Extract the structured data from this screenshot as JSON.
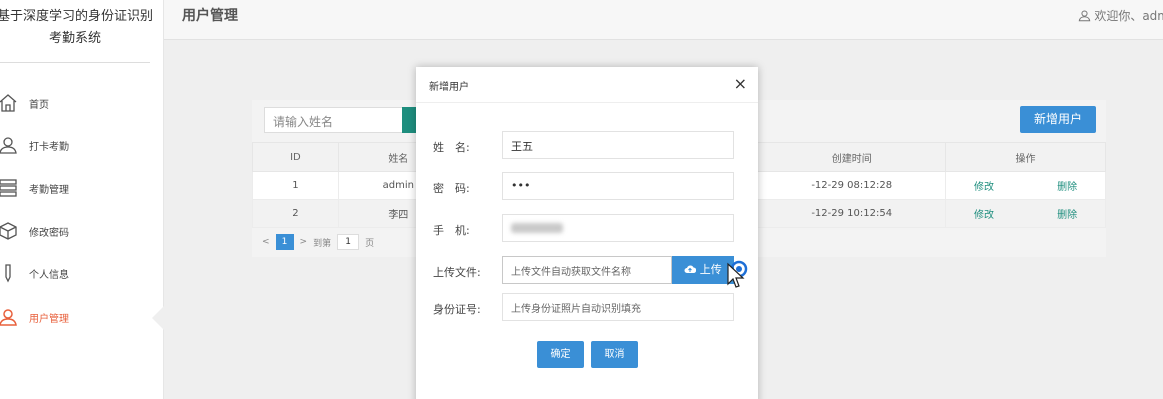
{
  "sidebar": {
    "brand_line1": "基于深度学习的身份证识别",
    "brand_line2": "考勤系统",
    "items": [
      {
        "label": "首页",
        "icon": "home-icon"
      },
      {
        "label": "打卡考勤",
        "icon": "user-icon"
      },
      {
        "label": "考勤管理",
        "icon": "list-icon"
      },
      {
        "label": "修改密码",
        "icon": "box-icon"
      },
      {
        "label": "个人信息",
        "icon": "pen-icon"
      },
      {
        "label": "用户管理",
        "icon": "user-manage-icon",
        "active": true
      }
    ]
  },
  "header": {
    "title": "用户管理",
    "welcome": "欢迎你、adm"
  },
  "toolbar": {
    "search_placeholder": "请输入姓名",
    "add_label": "新增用户"
  },
  "table": {
    "columns": [
      "ID",
      "姓名",
      "创建时间",
      "操作"
    ],
    "rows": [
      {
        "id": "1",
        "name": "admin",
        "time": "-12-29 08:12:28",
        "edit": "修改",
        "delete": "删除"
      },
      {
        "id": "2",
        "name": "李四",
        "time": "-12-29 10:12:54",
        "edit": "修改",
        "delete": "删除"
      }
    ]
  },
  "pager": {
    "current": "1",
    "goto_label": "到第",
    "goto_value": "1",
    "page_suffix": "页"
  },
  "modal": {
    "title": "新增用户",
    "close": "×",
    "name_label": "姓　名:",
    "name_value": "王五",
    "password_label": "密　码:",
    "password_value": "•••",
    "phone_label": "手　机:",
    "upload_label": "上传文件:",
    "upload_placeholder": "上传文件自动获取文件名称",
    "upload_button": "上传",
    "idcard_label": "身份证号:",
    "idcard_placeholder": "上传身份证照片自动识别填充",
    "confirm": "确定",
    "cancel": "取消"
  },
  "colors": {
    "primary": "#3a8fd6",
    "teal": "#1e8e7e",
    "active": "#e8603c"
  }
}
